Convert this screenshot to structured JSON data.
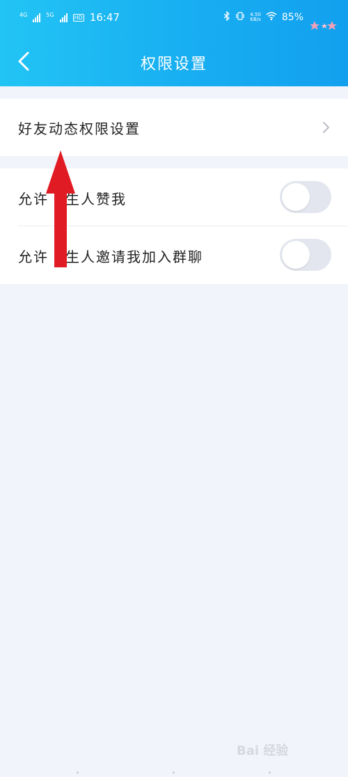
{
  "status_bar": {
    "net1": "4G",
    "net2": "5G",
    "hd": "HD",
    "time": "16:47",
    "speed_top": "4.50",
    "speed_bottom": "KB/s",
    "battery": "85%"
  },
  "header": {
    "title": "权限设置",
    "back_icon": "chevron-left-icon"
  },
  "settings": {
    "friend_feed": {
      "label": "好友动态权限设置",
      "icon": "chevron-right-icon"
    },
    "toggles": [
      {
        "label_a": "允许",
        "label_b": "生人赞我",
        "on": false
      },
      {
        "label_a": "允许",
        "label_b": "生人邀请我加入群聊",
        "on": false
      }
    ]
  },
  "annotation": {
    "color": "#e01b24",
    "icon": "red-up-arrow"
  },
  "watermark": {
    "text": "Bai 经验"
  },
  "colors": {
    "header_start": "#22c4f4",
    "header_end": "#12a0ee",
    "background": "#f1f4fb"
  }
}
